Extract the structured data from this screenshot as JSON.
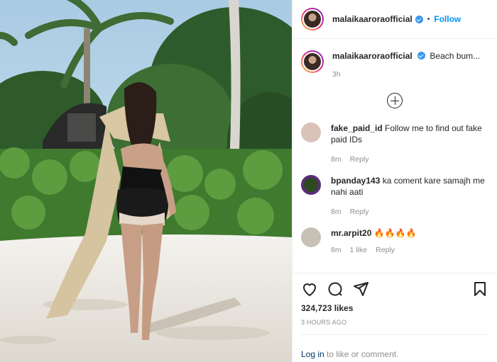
{
  "post": {
    "author": "malaikaaroraofficial",
    "follow_label": "Follow",
    "dot": "•",
    "caption": "Beach bum...",
    "caption_time": "3h",
    "likes": "324,723 likes",
    "time_ago": "3 HOURS AGO",
    "login_link": "Log in",
    "login_text": " to like or comment."
  },
  "comments": [
    {
      "user": "fake_paid_id",
      "text": "Follow me to find out fake paid IDs",
      "time": "8m",
      "likes": "",
      "reply": "Reply",
      "avatar_color": "#d9c2b8"
    },
    {
      "user": "bpanday143",
      "text": "ka coment kare samajh me nahi aati",
      "time": "8m",
      "likes": "",
      "reply": "Reply",
      "avatar_color": "#2d4a1e"
    },
    {
      "user": "mr.arpit20",
      "text": "🔥🔥🔥🔥",
      "time": "8m",
      "likes": "1 like",
      "reply": "Reply",
      "avatar_color": "#c7c1b5"
    }
  ],
  "colors": {
    "accent": "#0095f6",
    "verified": "#3897f0",
    "muted": "#8e8e8e"
  },
  "icons": [
    "heart-icon",
    "comment-icon",
    "share-icon",
    "bookmark-icon",
    "add-circle-icon",
    "verified-icon"
  ]
}
